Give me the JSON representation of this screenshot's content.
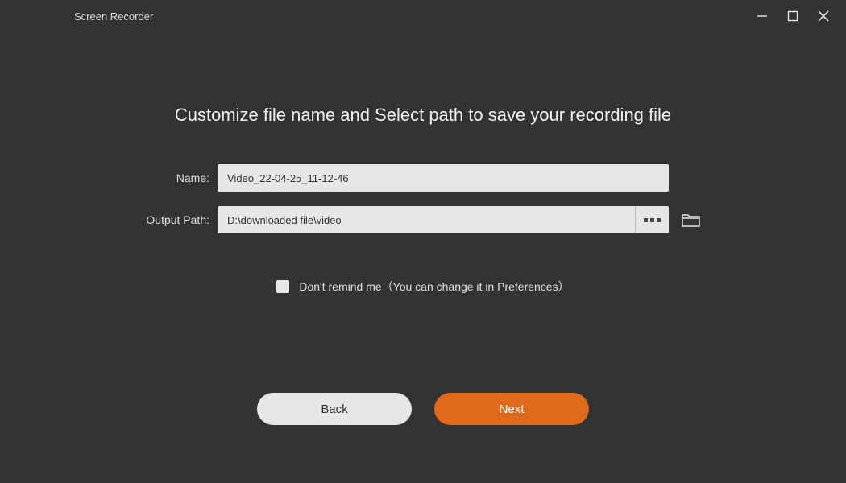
{
  "window": {
    "title": "Screen Recorder"
  },
  "heading": "Customize file name and Select path to save your recording file",
  "form": {
    "name_label": "Name:",
    "name_value": "Video_22-04-25_11-12-46",
    "path_label": "Output Path:",
    "path_value": "D:\\downloaded file\\video"
  },
  "reminder": {
    "label": "Don't remind me（You can change it in Preferences）"
  },
  "buttons": {
    "back": "Back",
    "next": "Next"
  },
  "colors": {
    "accent": "#e06a1b",
    "bg": "#333333",
    "input_bg": "#e6e6e6"
  }
}
